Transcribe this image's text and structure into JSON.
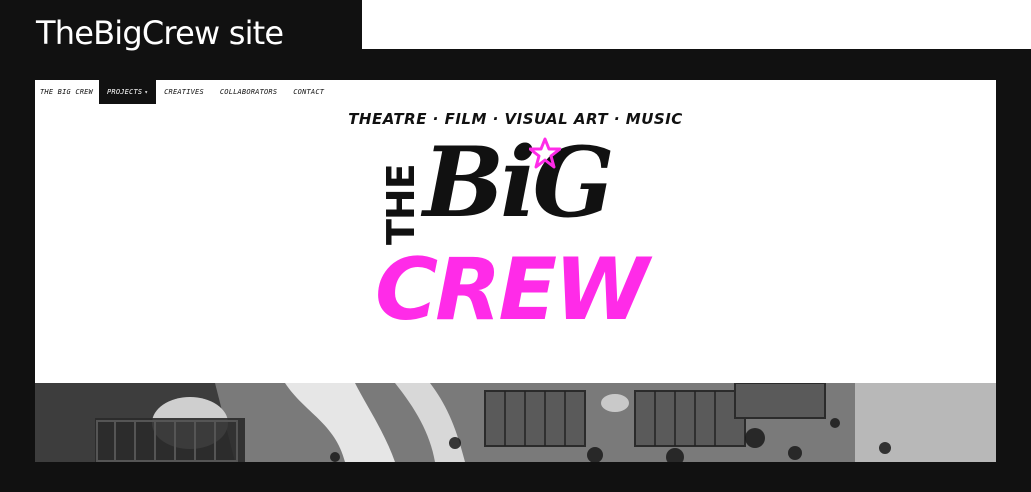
{
  "window": {
    "title": "TheBigCrew site"
  },
  "nav": {
    "brand": "THE BIG CREW",
    "items": [
      {
        "label": "PROJECTS",
        "active": true,
        "has_dropdown": true
      },
      {
        "label": "CREATIVES",
        "active": false
      },
      {
        "label": "COLLABORATORS",
        "active": false
      },
      {
        "label": "CONTACT",
        "active": false
      }
    ]
  },
  "hero": {
    "tagline": "THEATRE · FILM · VISUAL ART · MUSIC",
    "logo": {
      "line1": "THE",
      "line2": "BiG",
      "line3": "CREW"
    }
  },
  "colors": {
    "accent": "#ff2be8",
    "dark": "#111111",
    "background": "#ffffff"
  },
  "icons": {
    "dropdown": "chevron-down-icon",
    "logo_star": "star-icon"
  }
}
